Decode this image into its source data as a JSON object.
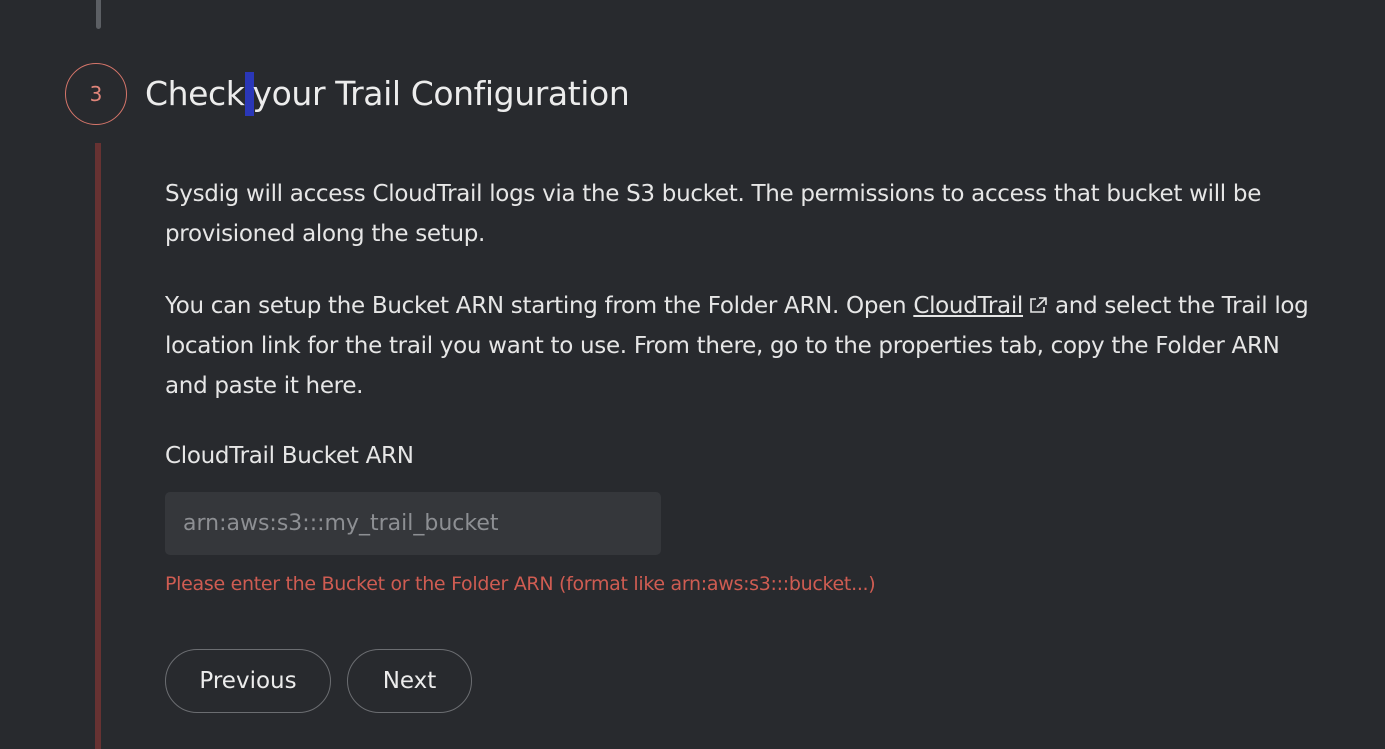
{
  "step": {
    "number": "3",
    "title_before_caret": "Check",
    "title_after_caret": "your Trail Configuration"
  },
  "description": {
    "paragraph1": "Sysdig will access CloudTrail logs via the S3 bucket. The permissions to access that bucket will be provisioned along the setup.",
    "paragraph2_before_link": "You can setup the Bucket ARN starting from the Folder ARN. Open ",
    "link_text": "CloudTrail",
    "link_icon": "external-link-icon",
    "paragraph2_after_link": "and select the Trail log location link for the trail you want to use. From there, go to the properties tab, copy the Folder ARN and paste it here."
  },
  "field": {
    "label": "CloudTrail Bucket ARN",
    "value": "",
    "placeholder": "arn:aws:s3:::my_trail_bucket",
    "error": "Please enter the Bucket or the Folder ARN (format like arn:aws:s3:::bucket...)"
  },
  "buttons": {
    "previous_label": "Previous",
    "next_label": "Next"
  },
  "colors": {
    "background": "#282a2e",
    "step_accent": "#d5756a",
    "rail": "#673232",
    "error": "#cf5c52",
    "text_caret": "#2a37b8"
  }
}
